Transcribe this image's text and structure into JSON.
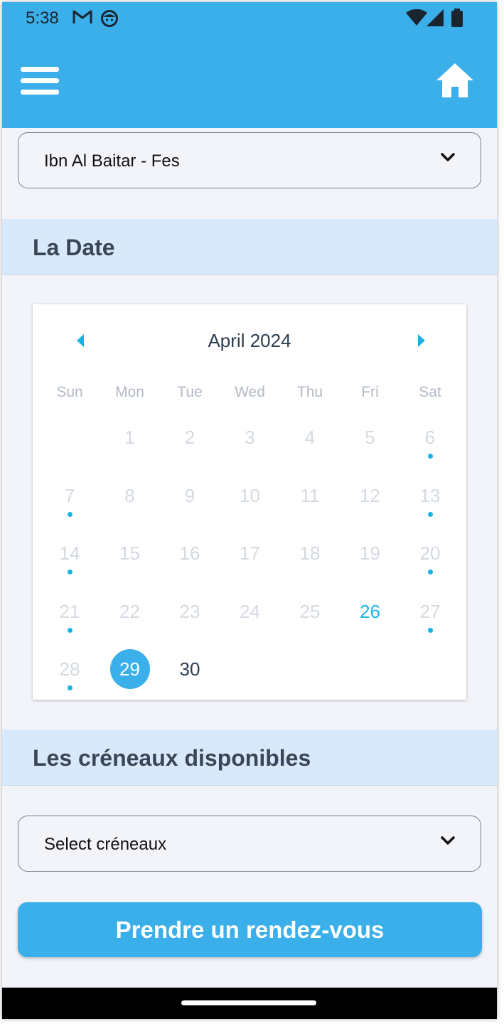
{
  "status_bar": {
    "time": "5:38",
    "icons": [
      "gmail-icon",
      "face-icon",
      "wifi-icon",
      "signal-icon",
      "battery-icon"
    ]
  },
  "app_bar": {
    "menu_icon": "hamburger-menu-icon",
    "home_icon": "home-icon",
    "color": "#3aafea"
  },
  "center_select": {
    "value": "Ibn Al Baitar - Fes"
  },
  "date_section": {
    "title": "La Date"
  },
  "calendar": {
    "month_label": "April 2024",
    "weekdays": [
      "Sun",
      "Mon",
      "Tue",
      "Wed",
      "Thu",
      "Fri",
      "Sat"
    ],
    "days": [
      {
        "day": "1",
        "state": "disabled",
        "dot": false
      },
      {
        "day": "2",
        "state": "disabled",
        "dot": false
      },
      {
        "day": "3",
        "state": "disabled",
        "dot": false
      },
      {
        "day": "4",
        "state": "disabled",
        "dot": false
      },
      {
        "day": "5",
        "state": "disabled",
        "dot": false
      },
      {
        "day": "6",
        "state": "disabled",
        "dot": true
      },
      {
        "day": "7",
        "state": "disabled",
        "dot": true
      },
      {
        "day": "8",
        "state": "disabled",
        "dot": false
      },
      {
        "day": "9",
        "state": "disabled",
        "dot": false
      },
      {
        "day": "10",
        "state": "disabled",
        "dot": false
      },
      {
        "day": "11",
        "state": "disabled",
        "dot": false
      },
      {
        "day": "12",
        "state": "disabled",
        "dot": false
      },
      {
        "day": "13",
        "state": "disabled",
        "dot": true
      },
      {
        "day": "14",
        "state": "disabled",
        "dot": true
      },
      {
        "day": "15",
        "state": "disabled",
        "dot": false
      },
      {
        "day": "16",
        "state": "disabled",
        "dot": false
      },
      {
        "day": "17",
        "state": "disabled",
        "dot": false
      },
      {
        "day": "18",
        "state": "disabled",
        "dot": false
      },
      {
        "day": "19",
        "state": "disabled",
        "dot": false
      },
      {
        "day": "20",
        "state": "disabled",
        "dot": true
      },
      {
        "day": "21",
        "state": "disabled",
        "dot": true
      },
      {
        "day": "22",
        "state": "disabled",
        "dot": false
      },
      {
        "day": "23",
        "state": "disabled",
        "dot": false
      },
      {
        "day": "24",
        "state": "disabled",
        "dot": false
      },
      {
        "day": "25",
        "state": "disabled",
        "dot": false
      },
      {
        "day": "26",
        "state": "today",
        "dot": false
      },
      {
        "day": "27",
        "state": "disabled",
        "dot": true
      },
      {
        "day": "28",
        "state": "disabled",
        "dot": true
      },
      {
        "day": "29",
        "state": "selected",
        "dot": false
      },
      {
        "day": "30",
        "state": "available",
        "dot": false
      }
    ],
    "colors": {
      "accent": "#1ab4e6",
      "selected": "#3aafea",
      "disabled": "#d4dae1"
    }
  },
  "slots_section": {
    "title": "Les créneaux disponibles"
  },
  "slots_select": {
    "value": "Select créneaux"
  },
  "submit_button": {
    "label": "Prendre un rendez-vous"
  }
}
